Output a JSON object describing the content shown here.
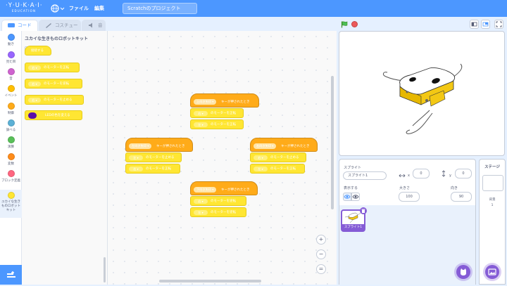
{
  "menubar": {
    "logo_line1": "·Y·U·K·A·I·",
    "logo_line2": "EDUCATION",
    "file_menu": "ファイル",
    "edit_menu": "編集",
    "project_title": "Scratchのプロジェクト"
  },
  "tabs": {
    "code": "コード",
    "costumes": "コスチューム",
    "sounds": "音"
  },
  "categories": [
    {
      "label": "動き",
      "color": "#4c97ff"
    },
    {
      "label": "見た目",
      "color": "#9966ff"
    },
    {
      "label": "音",
      "color": "#cf63cf"
    },
    {
      "label": "イベント",
      "color": "#ffbf00"
    },
    {
      "label": "制御",
      "color": "#ffab19"
    },
    {
      "label": "調べる",
      "color": "#5cb1d6"
    },
    {
      "label": "演算",
      "color": "#59c059"
    },
    {
      "label": "変数",
      "color": "#ff8c1a"
    },
    {
      "label": "ブロック定義",
      "color": "#ff6680"
    },
    {
      "label": "ユカイな生きものロボットキット",
      "color": "#ffe633"
    }
  ],
  "palette": {
    "heading": "ユカイな生きものロボットキット",
    "hat_label": "接続する",
    "blocks": [
      {
        "dropdown": "右 ▾",
        "text": "のモーターを正転"
      },
      {
        "dropdown": "右 ▾",
        "text": "のモーターを逆転"
      },
      {
        "dropdown": "右 ▾",
        "text": "のモーターを止める"
      },
      {
        "dropdown": "",
        "text": "LEDの色を変える"
      }
    ]
  },
  "scripts": [
    {
      "hat_dd": "上向き矢印 ▾",
      "hat_text": "キーが押されたとき",
      "steps": [
        {
          "dd": "右 ▾",
          "text": "のモーターを正転"
        },
        {
          "dd": "左 ▾",
          "text": "のモーターを正転"
        }
      ]
    },
    {
      "hat_dd": "左向き矢印 ▾",
      "hat_text": "キーが押されたとき",
      "steps": [
        {
          "dd": "左 ▾",
          "text": "のモーターを止める"
        },
        {
          "dd": "右 ▾",
          "text": "のモーターを正転"
        }
      ]
    },
    {
      "hat_dd": "右向き矢印 ▾",
      "hat_text": "キーが押されたとき",
      "steps": [
        {
          "dd": "右 ▾",
          "text": "のモーターを止める"
        },
        {
          "dd": "左 ▾",
          "text": "のモーターを正転"
        }
      ]
    },
    {
      "hat_dd": "下向き矢印 ▾",
      "hat_text": "キーが押されたとき",
      "steps": [
        {
          "dd": "右 ▾",
          "text": "のモーターを逆転"
        },
        {
          "dd": "左 ▾",
          "text": "のモーターを逆転"
        }
      ]
    }
  ],
  "zoom": {
    "in": "+",
    "out": "−",
    "reset": "="
  },
  "sprite": {
    "section_label": "スプライト",
    "name": "スプライト1",
    "x_label": "x",
    "x_value": "0",
    "y_label": "y",
    "y_value": "0",
    "show_label": "表示する",
    "size_label": "大きさ",
    "size_value": "100",
    "direction_label": "向き",
    "direction_value": "90",
    "thumb_label": "スプライト1"
  },
  "stage_pane": {
    "heading": "ステージ",
    "backdrops_label": "背景",
    "backdrops_count": "1"
  }
}
